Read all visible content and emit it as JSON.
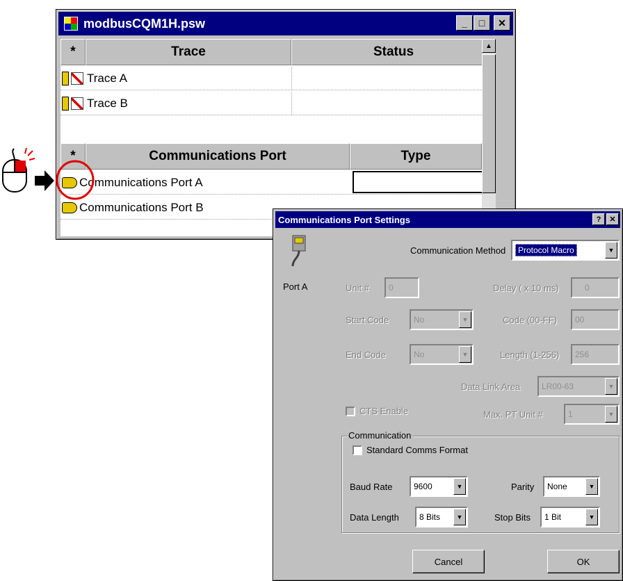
{
  "main_window": {
    "title": "modbusCQM1H.psw",
    "min_glyph": "_",
    "max_glyph": "□",
    "close_glyph": "✕",
    "trace_table": {
      "star": "*",
      "col_trace": "Trace",
      "col_status": "Status",
      "rows": [
        "Trace A",
        "Trace B"
      ]
    },
    "port_table": {
      "star": "*",
      "col_port": "Communications Port",
      "col_type": "Type",
      "rows": [
        "Communications Port A",
        "Communications Port B"
      ]
    },
    "scroll_up_glyph": "▲"
  },
  "dialog": {
    "title": "Communications Port Settings",
    "help_glyph": "?",
    "close_glyph": "✕",
    "port_label": "Port A",
    "communication_method_label": "Communication Method",
    "communication_method_value": "Protocol Macro",
    "unit_label": "Unit #",
    "unit_value": "0",
    "delay_label": "Delay ( x 10 ms)",
    "delay_value": "0",
    "start_code_label": "Start Code",
    "start_code_value": "No",
    "code_label": "Code (00-FF)",
    "code_value": "00",
    "end_code_label": "End Code",
    "end_code_value": "No",
    "length_label": "Length (1-256)",
    "length_value": "256",
    "data_link_label": "Data Link Area",
    "data_link_value": "LR00-63",
    "cts_label": "CTS Enable",
    "max_pt_label": "Max. PT Unit #",
    "max_pt_value": "1",
    "group_label": "Communication",
    "standard_comms_label": "Standard Comms Format",
    "baud_label": "Baud Rate",
    "baud_value": "9600",
    "parity_label": "Parity",
    "parity_value": "None",
    "data_length_label": "Data Length",
    "data_length_value": "8 Bits",
    "stop_bits_label": "Stop Bits",
    "stop_bits_value": "1 Bit",
    "cancel_label": "Cancel",
    "ok_label": "OK",
    "dropdown_glyph": "▼"
  },
  "colors": {
    "titlebar": "#000080",
    "highlight_circle": "#e00000",
    "window_face": "#c0c0c0"
  }
}
